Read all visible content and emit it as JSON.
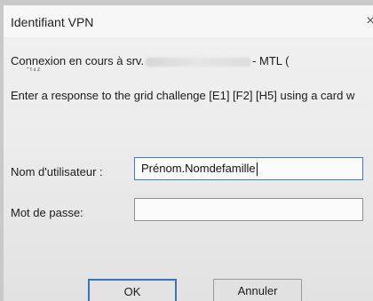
{
  "window": {
    "title": "Identifiant VPN",
    "close_glyph": "×"
  },
  "message": {
    "connecting_prefix": "Connexion en cours à srv.",
    "connecting_suffix": "- MTL (",
    "challenge": "Enter a response to the grid challenge [E1] [F2] [H5] using a card w"
  },
  "form": {
    "username_label": "Nom d'utilisateur :",
    "username_value": "Prénom.Nomdefamille",
    "password_label": "Mot de passe:",
    "password_value": ""
  },
  "buttons": {
    "ok_label": "OK",
    "cancel_label": "Annuler"
  },
  "colors": {
    "focus_border": "#3d7cc9",
    "default_button_border": "#3a73c0"
  }
}
